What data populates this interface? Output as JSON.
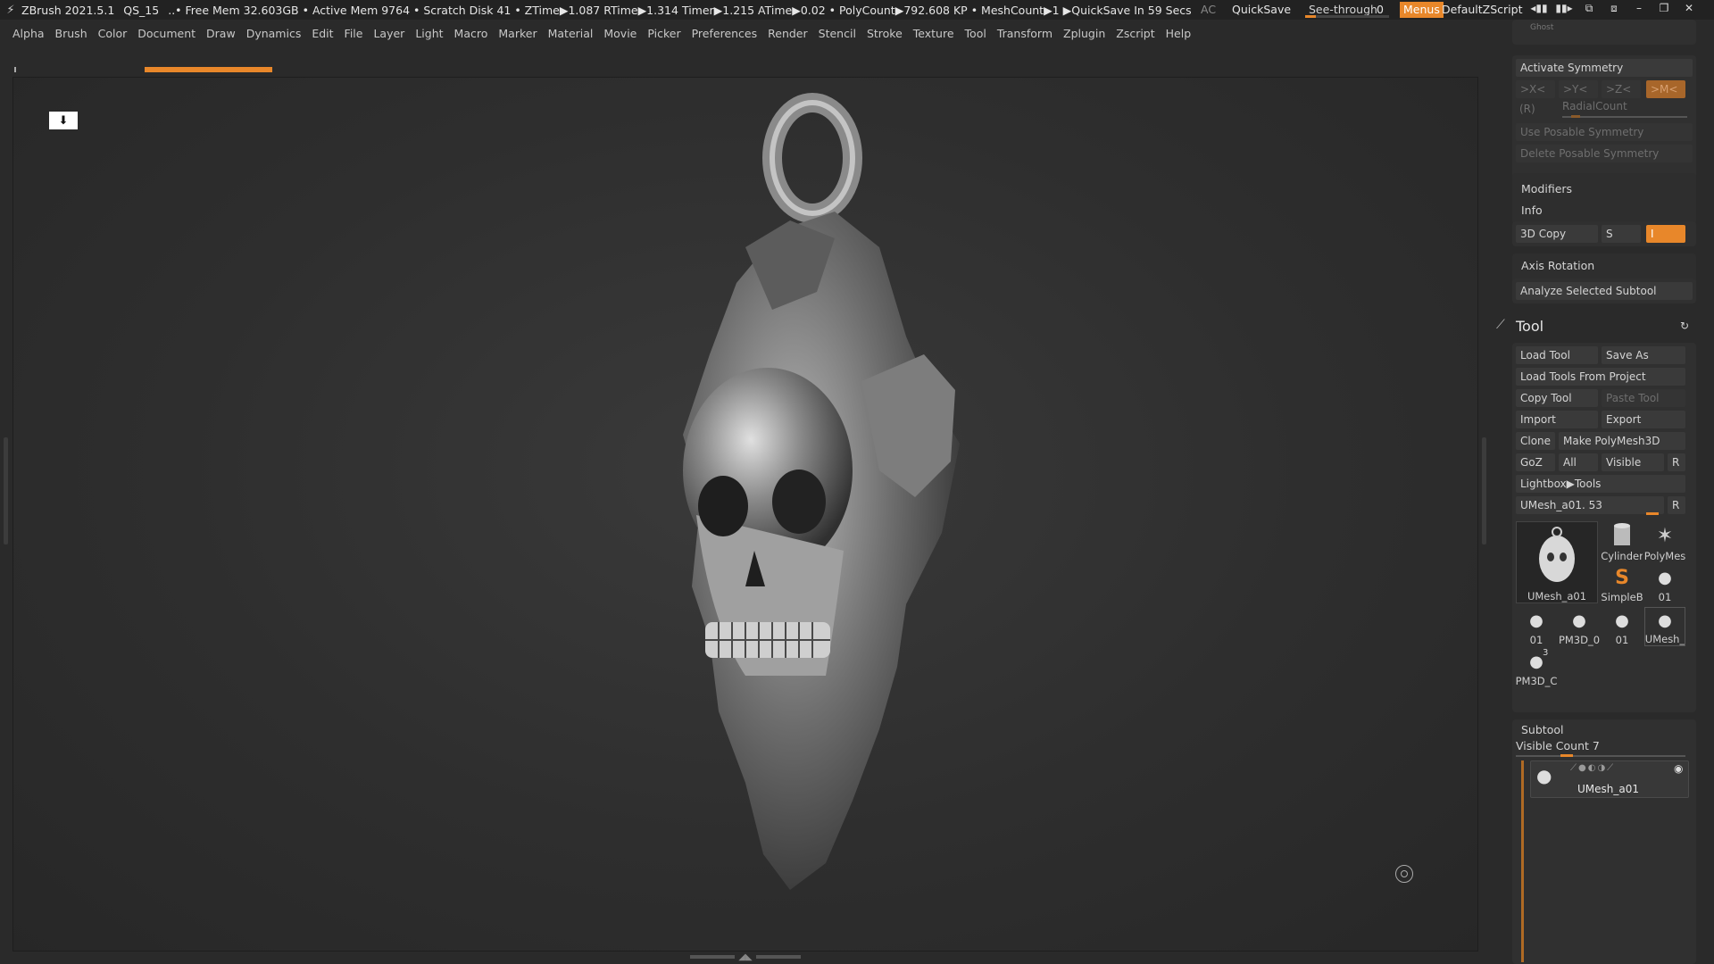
{
  "titlebar": {
    "app": "ZBrush 2021.5.1",
    "doc": "QS_15",
    "stats": "..• Free Mem 32.603GB • Active Mem 9764 • Scratch Disk 41 •  ZTime▶1.087 RTime▶1.314 Timer▶1.215 ATime▶0.02 • PolyCount▶792.608 KP  • MeshCount▶1  ▶QuickSave In 59 Secs",
    "ac": "AC",
    "quicksave": "QuickSave",
    "see_through_label": "See-through",
    "see_through_value": "0",
    "see_through_level": 0.0,
    "menus": "Menus",
    "script": "DefaultZScript"
  },
  "menubar": [
    "Alpha",
    "Brush",
    "Color",
    "Document",
    "Draw",
    "Dynamics",
    "Edit",
    "File",
    "Layer",
    "Light",
    "Macro",
    "Marker",
    "Material",
    "Movie",
    "Picker",
    "Preferences",
    "Render",
    "Stencil",
    "Stroke",
    "Texture",
    "Tool",
    "Transform",
    "Zplugin",
    "Zscript",
    "Help"
  ],
  "panel": {
    "ghost": "Ghost",
    "activate_symmetry": "Activate Symmetry",
    "sym_x": ">X<",
    "sym_y": ">Y<",
    "sym_z": ">Z<",
    "sym_m": ">M<",
    "sym_r": "(R)",
    "radial_count": "RadialCount",
    "use_posable": "Use Posable Symmetry",
    "delete_posable": "Delete Posable Symmetry",
    "modifiers": "Modifiers",
    "info": "Info",
    "copy3d": "3D Copy",
    "copy3d_s": "S",
    "copy3d_i": "I",
    "axis_rotation": "Axis Rotation",
    "analyze": "Analyze Selected Subtool",
    "tool_title": "Tool",
    "load_tool": "Load Tool",
    "save_as": "Save As",
    "load_from_project": "Load Tools From Project",
    "copy_tool": "Copy Tool",
    "paste_tool": "Paste Tool",
    "import": "Import",
    "export": "Export",
    "clone": "Clone",
    "make_polymesh": "Make PolyMesh3D",
    "goz": "GoZ",
    "all": "All",
    "visible": "Visible",
    "r": "R",
    "lightbox_tools": "Lightbox▶Tools",
    "current_tool": "UMesh_a01. 53",
    "current_tool_r": "R",
    "thumbs": {
      "main": "UMesh_a01",
      "cylinder": "Cylinder",
      "polymesh": "PolyMes",
      "simpleb": "SimpleB",
      "t01a": "01",
      "t01b": "01",
      "pm3d0": "PM3D_0",
      "t01c": "01",
      "umesh": "UMesh_",
      "pm3dc": "PM3D_C",
      "count3": "3"
    },
    "subtool": "Subtool",
    "visible_count": "Visible Count 7",
    "subtool_item": "UMesh_a01"
  }
}
